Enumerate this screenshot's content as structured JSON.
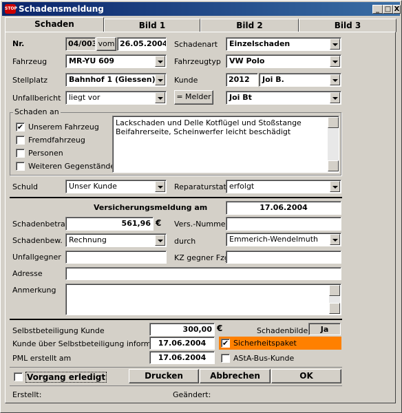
{
  "window": {
    "title": "Schadensmeldung",
    "title_icon": "STOP",
    "min": "_",
    "max": "□",
    "close": "X"
  },
  "tabs": [
    "Schaden",
    "Bild 1",
    "Bild 2",
    "Bild 3"
  ],
  "form": {
    "nr_label": "Nr.",
    "nr_value": "04/003",
    "vom_button": "vom",
    "date_value": "26.05.2004",
    "schadenart_label": "Schadenart",
    "schadenart_value": "Einzelschaden",
    "fahrzeug_label": "Fahrzeug",
    "fahrzeug_value": "MR-YU 609",
    "fahrzeugtyp_label": "Fahrzeugtyp",
    "fahrzeugtyp_value": "VW Polo",
    "stellplatz_label": "Stellplatz",
    "stellplatz_value": "Bahnhof 1 (Giessen)",
    "kunde_label": "Kunde",
    "kunde_nr": "2012",
    "kunde_name": "Joi B.",
    "unfallbericht_label": "Unfallbericht",
    "unfallbericht_value": "liegt vor",
    "melder_button": "= Melder",
    "melder_value": "Joi Bt",
    "schaden_an_label": "Schaden an",
    "schaden_an": [
      "Unserem Fahrzeug",
      "Fremdfahrzeug",
      "Personen",
      "Weiteren Gegenständen"
    ],
    "description": "Lackschaden und Delle Kotflügel und Stoßstange Beifahrerseite, Scheinwerfer leicht beschädigt",
    "schuld_label": "Schuld",
    "schuld_value": "Unser Kunde",
    "reparatur_label": "Reparaturstat.",
    "reparatur_value": "erfolgt",
    "versicherung_label": "Versicherungsmeldung am",
    "versicherung_date": "17.06.2004",
    "schadenbetrag_label": "Schadenbetrag",
    "schadenbetrag_value": "561,96",
    "currency": "€",
    "versnr_label": "Vers.-Nummer",
    "versnr_value": "",
    "schadenbew_label": "Schadenbew.",
    "schadenbew_value": "Rechnung",
    "durch_label": "durch",
    "durch_value": "Emmerich-Wendelmuth",
    "unfallgegner_label": "Unfallgegner",
    "unfallgegner_value": "",
    "kz_label": "KZ gegner Fzg",
    "kz_value": "",
    "adresse_label": "Adresse",
    "adresse_value": "",
    "anmerkung_label": "Anmerkung",
    "anmerkung_value": "",
    "selbst_label": "Selbstbeteiligung Kunde",
    "selbst_value": "300,00",
    "schadenbilder_label": "Schadenbilder",
    "schadenbilder_value": "Ja",
    "informiert_label": "Kunde über Selbstbeteiligung informiert",
    "informiert_value": "17.06.2004",
    "sicherheitspaket_label": "Sicherheitspaket",
    "pml_label": "PML erstellt am",
    "pml_value": "17.06.2004",
    "asta_label": "AStA-Bus-Kunde",
    "erledigt_label": "Vorgang erledigt",
    "drucken": "Drucken",
    "abbrechen": "Abbrechen",
    "ok": "OK",
    "erstellt_label": "Erstellt:",
    "geaendert_label": "Geändert:"
  },
  "colors": {
    "accent": "#ff8000",
    "titlebar": "#0a246a"
  }
}
